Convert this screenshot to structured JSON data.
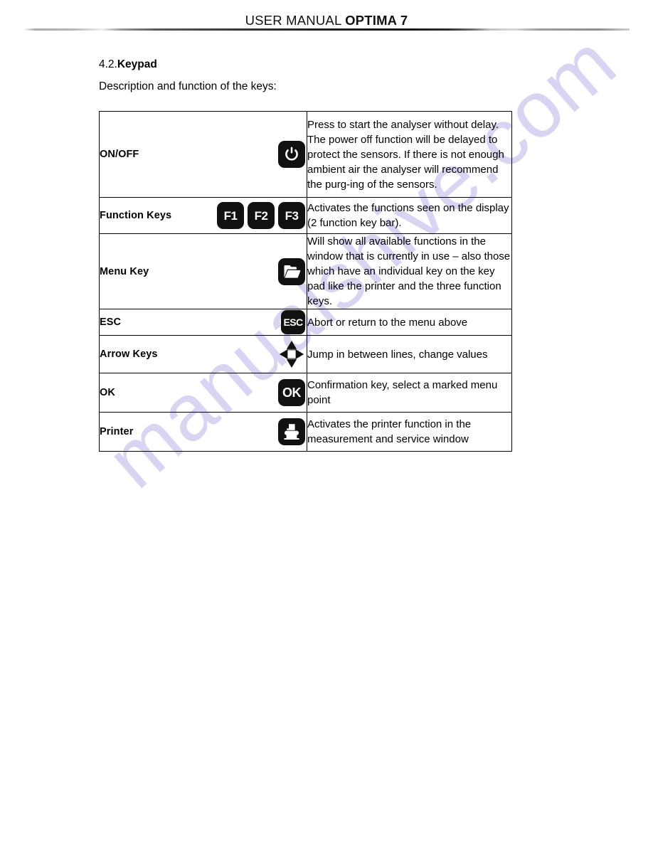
{
  "header": {
    "title_plain": "USER MANUAL ",
    "title_bold": "OPTIMA 7",
    "rule": "header-rule"
  },
  "watermark": {
    "text": "manualshive.com",
    "color": "#d6d3f2"
  },
  "section": {
    "number": "4.2.",
    "title": "Keypad",
    "intro": "Description and function of the keys:"
  },
  "table": {
    "rows": [
      {
        "key_label": "ON/OFF",
        "icons": [
          "power-icon"
        ],
        "description": "Press to start the analyser without delay. The power off function will be delayed to protect the sensors. If there is not enough ambient air the analyser will recommend the purg-ing of the sensors."
      },
      {
        "key_label": "Function Keys",
        "icons": [
          "f1-key",
          "f2-key",
          "f3-key"
        ],
        "icon_labels": [
          "F1",
          "F2",
          "F3"
        ],
        "description": "Activates the functions seen on the display (2 function key bar)."
      },
      {
        "key_label": "Menu Key",
        "icons": [
          "folder-icon"
        ],
        "description": "Will show all available functions in the window that is currently in use – also those which have an individual key on the key pad like the printer and the three function keys."
      },
      {
        "key_label": "ESC",
        "icons": [
          "esc-key"
        ],
        "icon_labels": [
          "ESC"
        ],
        "description": "Abort or return to the menu above"
      },
      {
        "key_label": "Arrow Keys",
        "icons": [
          "dpad-icon"
        ],
        "description": "Jump in between lines, change values"
      },
      {
        "key_label": "OK",
        "icons": [
          "ok-key"
        ],
        "icon_labels": [
          "OK"
        ],
        "description": "Confirmation key, select a marked menu point"
      },
      {
        "key_label": "Printer",
        "icons": [
          "printer-icon"
        ],
        "description": "Activates the printer function in the measurement and service window"
      }
    ]
  }
}
